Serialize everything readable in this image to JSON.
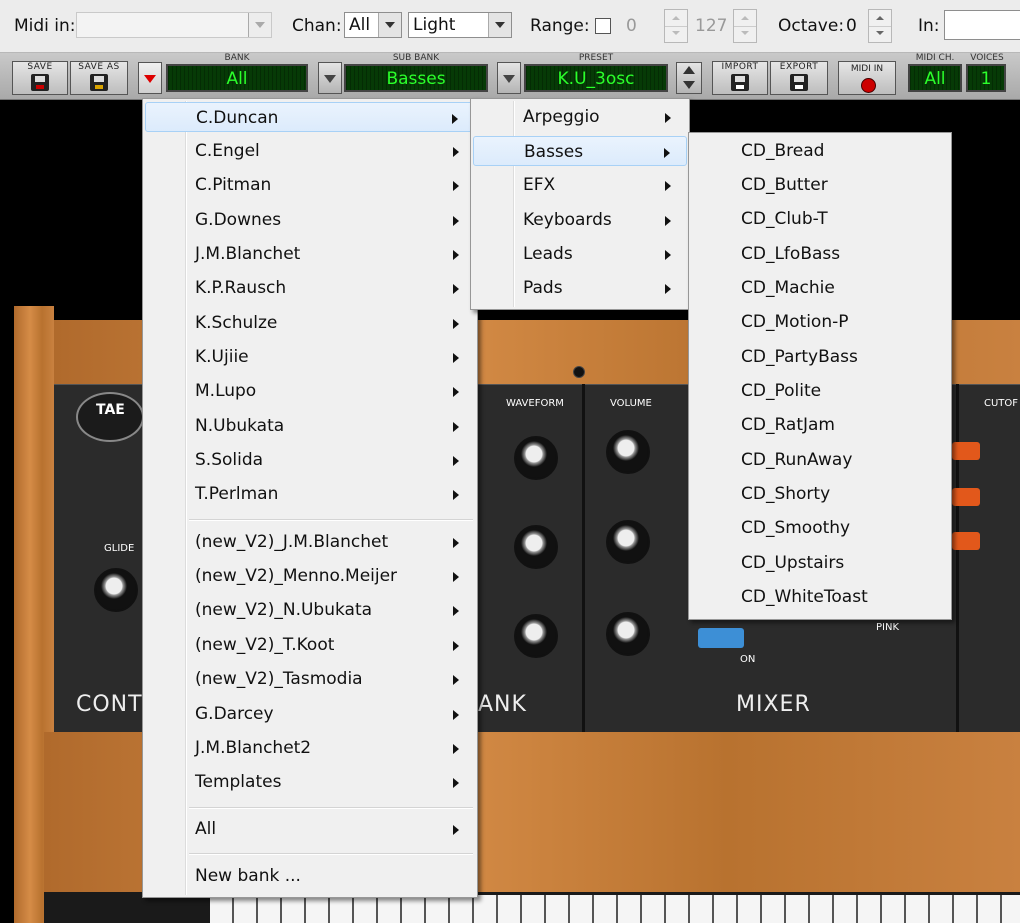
{
  "topbar": {
    "midi_in_label": "Midi in:",
    "midi_in_value": "",
    "chan_label": "Chan:",
    "chan_value": "All",
    "skin_value": "Light",
    "range_label": "Range:",
    "range_low": "0",
    "range_high": "127",
    "octave_label": "Octave:",
    "octave_value": "0",
    "in_label": "In:"
  },
  "toolbar": {
    "save_label": "SAVE",
    "save_as_label": "SAVE AS",
    "bank_label": "BANK",
    "bank_value": "All",
    "subbank_label": "SUB BANK",
    "subbank_value": "Basses",
    "preset_label": "PRESET",
    "preset_value": "K.U_3osc",
    "import_label": "IMPORT",
    "export_label": "EXPORT",
    "midi_in_label": "MIDI IN",
    "midi_ch_label": "MIDI CH.",
    "midi_ch_value": "All",
    "voices_label": "VOICES",
    "voices_value": "1"
  },
  "synth": {
    "logo": "TAE",
    "sections": {
      "controllers": "CONT",
      "oscillator_bank": "ANK",
      "mixer": "MIXER"
    },
    "labels": {
      "glide": "GLIDE",
      "waveform": "WAVEFORM",
      "volume": "VOLUME",
      "cutoff": "CUTOF",
      "on": "ON",
      "pink": "PINK"
    }
  },
  "menus": {
    "bank_menu": {
      "group1": [
        "C.Duncan",
        "C.Engel",
        "C.Pitman",
        "G.Downes",
        "J.M.Blanchet",
        "K.P.Rausch",
        "K.Schulze",
        "K.Ujiie",
        "M.Lupo",
        "N.Ubukata",
        "S.Solida",
        "T.Perlman"
      ],
      "group2": [
        "(new_V2)_J.M.Blanchet",
        "(new_V2)_Menno.Meijer",
        "(new_V2)_N.Ubukata",
        "(new_V2)_T.Koot",
        "(new_V2)_Tasmodia",
        "G.Darcey",
        "J.M.Blanchet2",
        "Templates"
      ],
      "all": "All",
      "new_bank": "New bank ..."
    },
    "subbank_menu": [
      "Arpeggio",
      "Basses",
      "EFX",
      "Keyboards",
      "Leads",
      "Pads"
    ],
    "preset_menu": [
      "CD_Bread",
      "CD_Butter",
      "CD_Club-T",
      "CD_LfoBass",
      "CD_Machie",
      "CD_Motion-P",
      "CD_PartyBass",
      "CD_Polite",
      "CD_RatJam",
      "CD_RunAway",
      "CD_Shorty",
      "CD_Smoothy",
      "CD_Upstairs",
      "CD_WhiteToast"
    ]
  }
}
